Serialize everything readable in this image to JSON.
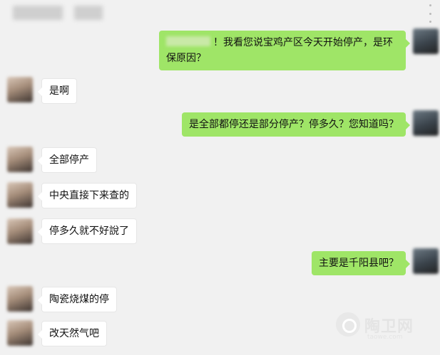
{
  "header": {
    "menu_icon": "more-vertical-icon"
  },
  "messages": [
    {
      "side": "right",
      "text": "！我看您说宝鸡产区今天开始停产，是环保原因？",
      "name_blurred": true
    },
    {
      "side": "left",
      "text": "是啊"
    },
    {
      "side": "right",
      "text": "是全部都停还是部分停产？停多久？您知道吗？"
    },
    {
      "side": "left",
      "text": "全部停产"
    },
    {
      "side": "left",
      "text": "中央直接下来查的"
    },
    {
      "side": "left",
      "text": "停多久就不好說了"
    },
    {
      "side": "right",
      "text": "主要是千阳县吧？"
    },
    {
      "side": "left",
      "text": "陶瓷烧煤的停"
    },
    {
      "side": "left",
      "text": "改天然气吧"
    }
  ],
  "watermark": {
    "brand": "陶卫网",
    "url": "taowe.com",
    "logo_icon": "taowei-logo-icon"
  },
  "colors": {
    "background": "#f1f1f1",
    "sent_bubble": "#9fe567",
    "received_bubble": "#ffffff"
  }
}
